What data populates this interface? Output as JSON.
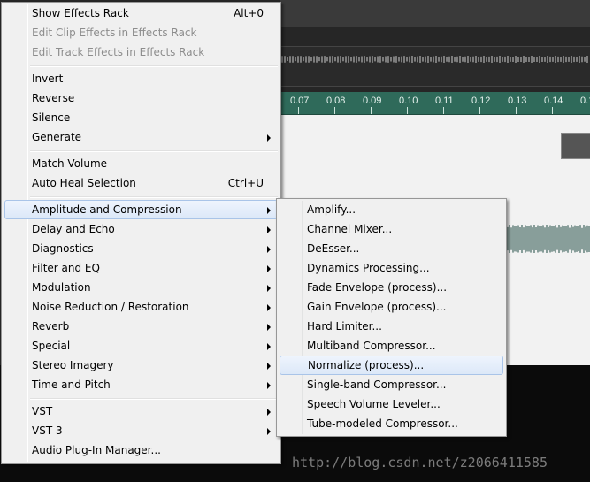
{
  "ruler": {
    "ticks": [
      "0.07",
      "0.08",
      "0.09",
      "0.10",
      "0.11",
      "0.12",
      "0.13",
      "0.14",
      "0.1"
    ]
  },
  "watermark": "http://blog.csdn.net/z2066411585",
  "colors": {
    "menu_bg": "#f0f0f0",
    "menu_highlight": "#dce8f8",
    "ruler_bg": "#2f6a5a",
    "wave_color": "#1f4a42",
    "disabled_text": "#8d8d8d"
  },
  "main_menu": {
    "items": [
      {
        "label": "Show Effects Rack",
        "shortcut": "Alt+0"
      },
      {
        "label": "Edit Clip Effects in Effects Rack",
        "disabled": true
      },
      {
        "label": "Edit Track Effects in Effects Rack",
        "disabled": true
      },
      {
        "label": "Invert"
      },
      {
        "label": "Reverse"
      },
      {
        "label": "Silence"
      },
      {
        "label": "Generate",
        "submenu": true
      },
      {
        "label": "Match Volume"
      },
      {
        "label": "Auto Heal Selection",
        "shortcut": "Ctrl+U"
      },
      {
        "label": "Amplitude and Compression",
        "submenu": true,
        "highlighted": true
      },
      {
        "label": "Delay and Echo",
        "submenu": true
      },
      {
        "label": "Diagnostics",
        "submenu": true
      },
      {
        "label": "Filter and EQ",
        "submenu": true
      },
      {
        "label": "Modulation",
        "submenu": true
      },
      {
        "label": "Noise Reduction / Restoration",
        "submenu": true
      },
      {
        "label": "Reverb",
        "submenu": true
      },
      {
        "label": "Special",
        "submenu": true
      },
      {
        "label": "Stereo Imagery",
        "submenu": true
      },
      {
        "label": "Time and Pitch",
        "submenu": true
      },
      {
        "label": "VST",
        "submenu": true
      },
      {
        "label": "VST 3",
        "submenu": true
      },
      {
        "label": "Audio Plug-In Manager..."
      }
    ]
  },
  "sub_menu": {
    "items": [
      {
        "label": "Amplify..."
      },
      {
        "label": "Channel Mixer..."
      },
      {
        "label": "DeEsser..."
      },
      {
        "label": "Dynamics Processing..."
      },
      {
        "label": "Fade Envelope (process)..."
      },
      {
        "label": "Gain Envelope (process)..."
      },
      {
        "label": "Hard Limiter..."
      },
      {
        "label": "Multiband Compressor..."
      },
      {
        "label": "Normalize (process)...",
        "highlighted": true
      },
      {
        "label": "Single-band Compressor..."
      },
      {
        "label": "Speech Volume Leveler..."
      },
      {
        "label": "Tube-modeled Compressor..."
      }
    ]
  }
}
